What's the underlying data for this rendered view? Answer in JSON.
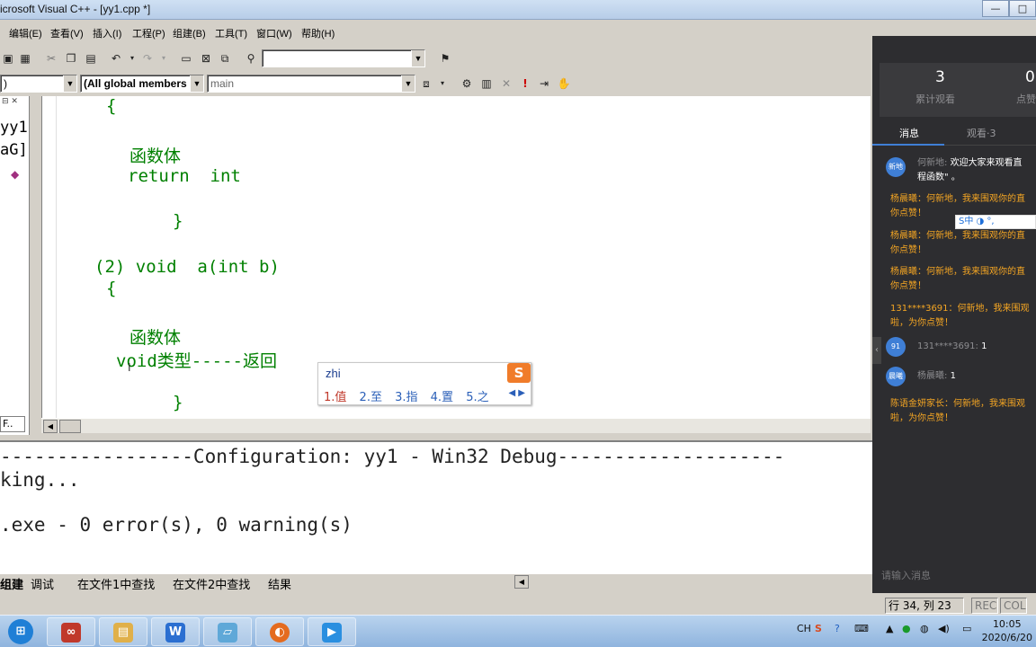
{
  "window": {
    "title": "icrosoft Visual C++ - [yy1.cpp *]",
    "buttons": [
      "—",
      "□"
    ]
  },
  "menu": [
    "编辑(E)",
    "查看(V)",
    "插入(I)",
    "工程(P)",
    "组建(B)",
    "工具(T)",
    "窗口(W)",
    "帮助(H)"
  ],
  "toolbar": {
    "find_combo_value": "",
    "class_combo_value": ")",
    "members_combo_value": "(All global members",
    "function_combo_value": "main"
  },
  "workspace": {
    "lines": [
      "yy1",
      "aG]"
    ]
  },
  "editor": {
    "lines": [
      "{",
      "函数体",
      "return  int",
      "}",
      "(2) void  a(int b)",
      "{",
      "函数体",
      "void类型-----返回",
      "}"
    ]
  },
  "ime": {
    "pinyin": "zhi",
    "candidates": [
      "1.值",
      "2.至",
      "3.指",
      "4.置",
      "5.之"
    ]
  },
  "output": {
    "lines": [
      "-----------------Configuration: yy1 - Win32 Debug--------------------",
      "king...",
      "",
      ".exe - 0 error(s), 0 warning(s)"
    ],
    "tabs": [
      "组建",
      "调试",
      "在文件1中查找",
      "在文件2中查找",
      "结果"
    ]
  },
  "statusbar": {
    "position": "行 34, 列 23",
    "rec": "REC",
    "col": "COL"
  },
  "workspace_tab": "F..",
  "live_panel": {
    "stats": [
      {
        "value": "3",
        "label": "累计观看"
      },
      {
        "value": "0",
        "label": "点赞"
      }
    ],
    "tabs": [
      "消息",
      "观看·3"
    ],
    "messages": [
      {
        "avatar": "新地",
        "sender": "何新地:",
        "text": "欢迎大家来观看直",
        "text2": "程函数\" 。",
        "style": "gray"
      },
      {
        "text": "杨晨曦：何新地，我来围观你的直",
        "text2": "你点赞！",
        "style": "orange"
      },
      {
        "text": "杨晨曦：何新地，我来围观你的直",
        "text2": "你点赞！",
        "style": "orange"
      },
      {
        "text": "杨晨曦：何新地，我来围观你的直",
        "text2": "你点赞！",
        "style": "orange"
      },
      {
        "text": "131****3691：何新地，我来围观",
        "text2": "啦，为你点赞！",
        "style": "orange"
      },
      {
        "avatar": "91",
        "sender": "131****3691:",
        "text": "1",
        "style": "gray"
      },
      {
        "avatar": "晨曦",
        "sender": "杨晨曦:",
        "text": "1",
        "style": "gray"
      },
      {
        "text": "陈语金妍家长：何新地，我来围观",
        "text2": "啦，为你点赞！",
        "style": "orange"
      }
    ],
    "input_placeholder": "请输入消息",
    "ime_bar": "S中 ◑ °,"
  },
  "taskbar": {
    "tray_lang": "CH",
    "time": "10:05",
    "date": "2020/6/20"
  }
}
